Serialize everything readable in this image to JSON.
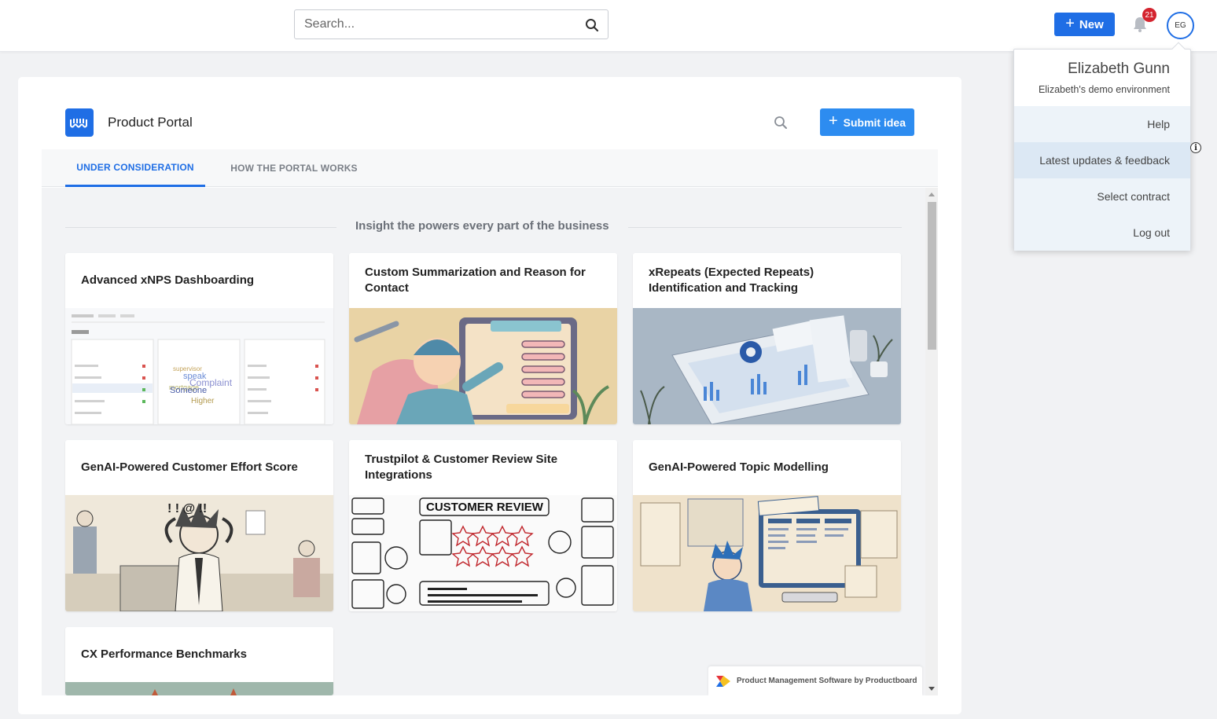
{
  "topbar": {
    "search_placeholder": "Search...",
    "new_label": "New",
    "notification_count": "21",
    "avatar_initials": "EG"
  },
  "user_menu": {
    "name": "Elizabeth Gunn",
    "environment": "Elizabeth's demo environment",
    "items": [
      {
        "label": "Help"
      },
      {
        "label": "Latest updates & feedback"
      },
      {
        "label": "Select contract"
      },
      {
        "label": "Log out"
      }
    ]
  },
  "portal": {
    "title": "Product Portal",
    "submit_label": "Submit idea",
    "tabs": [
      {
        "label": "UNDER CONSIDERATION"
      },
      {
        "label": "HOW THE PORTAL WORKS"
      }
    ],
    "section_title": "Insight the powers every part of the business",
    "cards": [
      {
        "title": "Advanced xNPS Dashboarding"
      },
      {
        "title": "Custom Summarization and Reason for Contact"
      },
      {
        "title": "xRepeats (Expected Repeats) Identification and Tracking"
      },
      {
        "title": "GenAI-Powered Customer Effort Score"
      },
      {
        "title": "Trustpilot & Customer Review Site Integrations"
      },
      {
        "title": "GenAI-Powered Topic Modelling"
      },
      {
        "title": "CX Performance Benchmarks"
      }
    ],
    "footer_badge": "Product Management Software by Productboard"
  },
  "colors": {
    "primary": "#1f6ee5",
    "submit": "#2d8cf0",
    "badge": "#d4242f"
  }
}
